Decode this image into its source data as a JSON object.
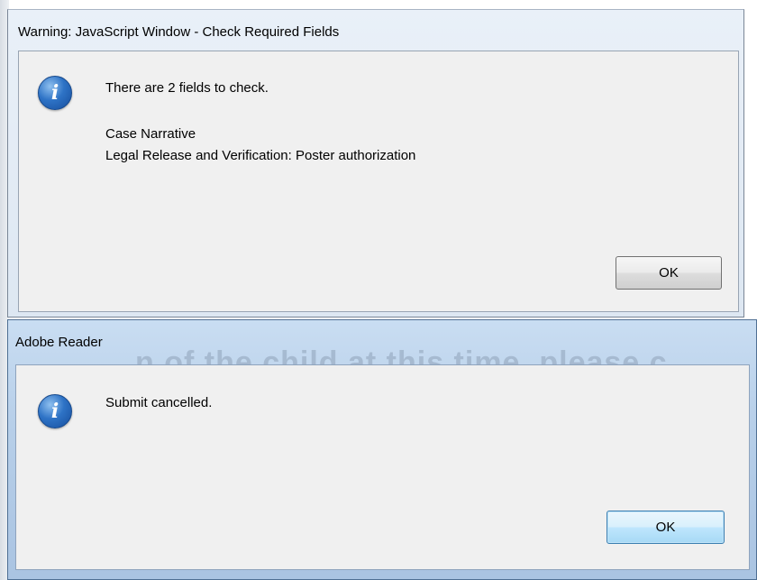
{
  "dialog_warning": {
    "title": "Warning: JavaScript Window - Check Required Fields",
    "icon": "info-icon",
    "message": "There are 2 fields to check.",
    "fields": [
      "Case Narrative",
      "Legal Release and Verification: Poster authorization"
    ],
    "ok_label": "OK"
  },
  "dialog_reader": {
    "title": "Adobe Reader",
    "background_text": "n of the child at this time, please c",
    "icon": "info-icon",
    "message": "Submit cancelled.",
    "ok_label": "OK"
  },
  "colors": {
    "client_bg": "#f0f0f0",
    "icon_blue": "#2e73c6",
    "focus_border": "#3c7fb1"
  }
}
